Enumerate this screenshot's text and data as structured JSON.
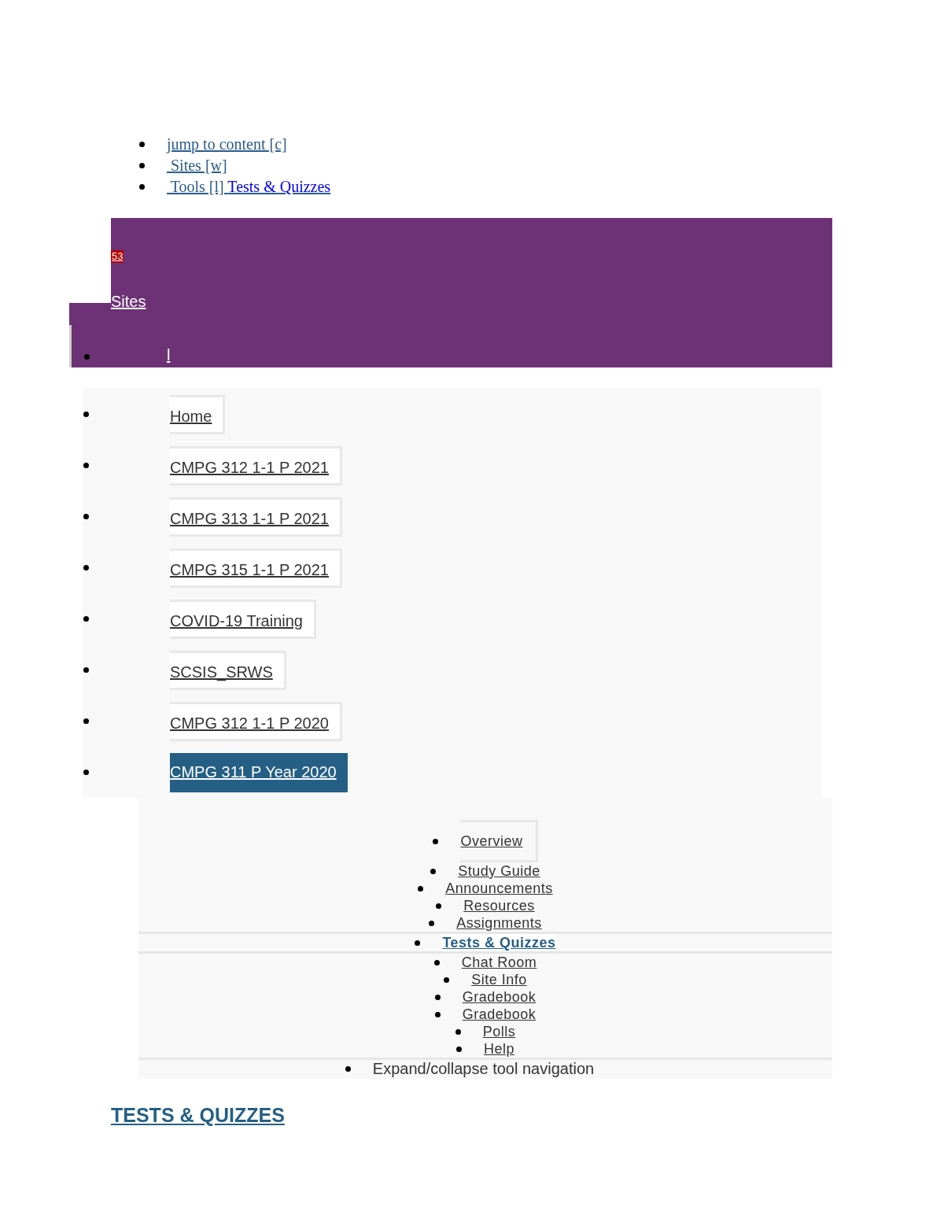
{
  "skip_links": [
    {
      "kind": "plain",
      "label": "jump to content [c]"
    },
    {
      "kind": "plain",
      "label": " Sites [w]"
    },
    {
      "kind": "tool",
      "label": " Tools [l] ",
      "current_tool": "Tests & Quizzes"
    }
  ],
  "header": {
    "badge": "53",
    "sites_link": "Sites",
    "menu_item": "l"
  },
  "sites": [
    {
      "label": "Home",
      "selected": false
    },
    {
      "label": "CMPG 312 1-1 P 2021",
      "selected": false
    },
    {
      "label": "CMPG 313 1-1 P 2021",
      "selected": false
    },
    {
      "label": "CMPG 315 1-1 P 2021",
      "selected": false
    },
    {
      "label": "COVID-19 Training",
      "selected": false
    },
    {
      "label": "SCSIS_SRWS",
      "selected": false
    },
    {
      "label": "CMPG 312 1-1 P 2020",
      "selected": false
    },
    {
      "label": "CMPG 311 P Year 2020",
      "selected": true
    }
  ],
  "tools": [
    {
      "label": "Overview",
      "selected": false,
      "kind": "boxed"
    },
    {
      "label": "Study Guide",
      "selected": false,
      "kind": "plain"
    },
    {
      "label": "Announcements",
      "selected": false,
      "kind": "plain"
    },
    {
      "label": "Resources",
      "selected": false,
      "kind": "plain"
    },
    {
      "label": "Assignments",
      "selected": false,
      "kind": "plain"
    },
    {
      "label": "Tests & Quizzes",
      "selected": true,
      "kind": "plain"
    },
    {
      "label": "Chat Room",
      "selected": false,
      "kind": "plain"
    },
    {
      "label": "Site Info",
      "selected": false,
      "kind": "plain"
    },
    {
      "label": "Gradebook",
      "selected": false,
      "kind": "plain"
    },
    {
      "label": "Gradebook",
      "selected": false,
      "kind": "plain"
    },
    {
      "label": "Polls",
      "selected": false,
      "kind": "plain"
    },
    {
      "label": "Help",
      "selected": false,
      "kind": "plain"
    }
  ],
  "expand_toggle": "Expand/collapse tool navigation",
  "page_title": "TESTS & QUIZZES"
}
